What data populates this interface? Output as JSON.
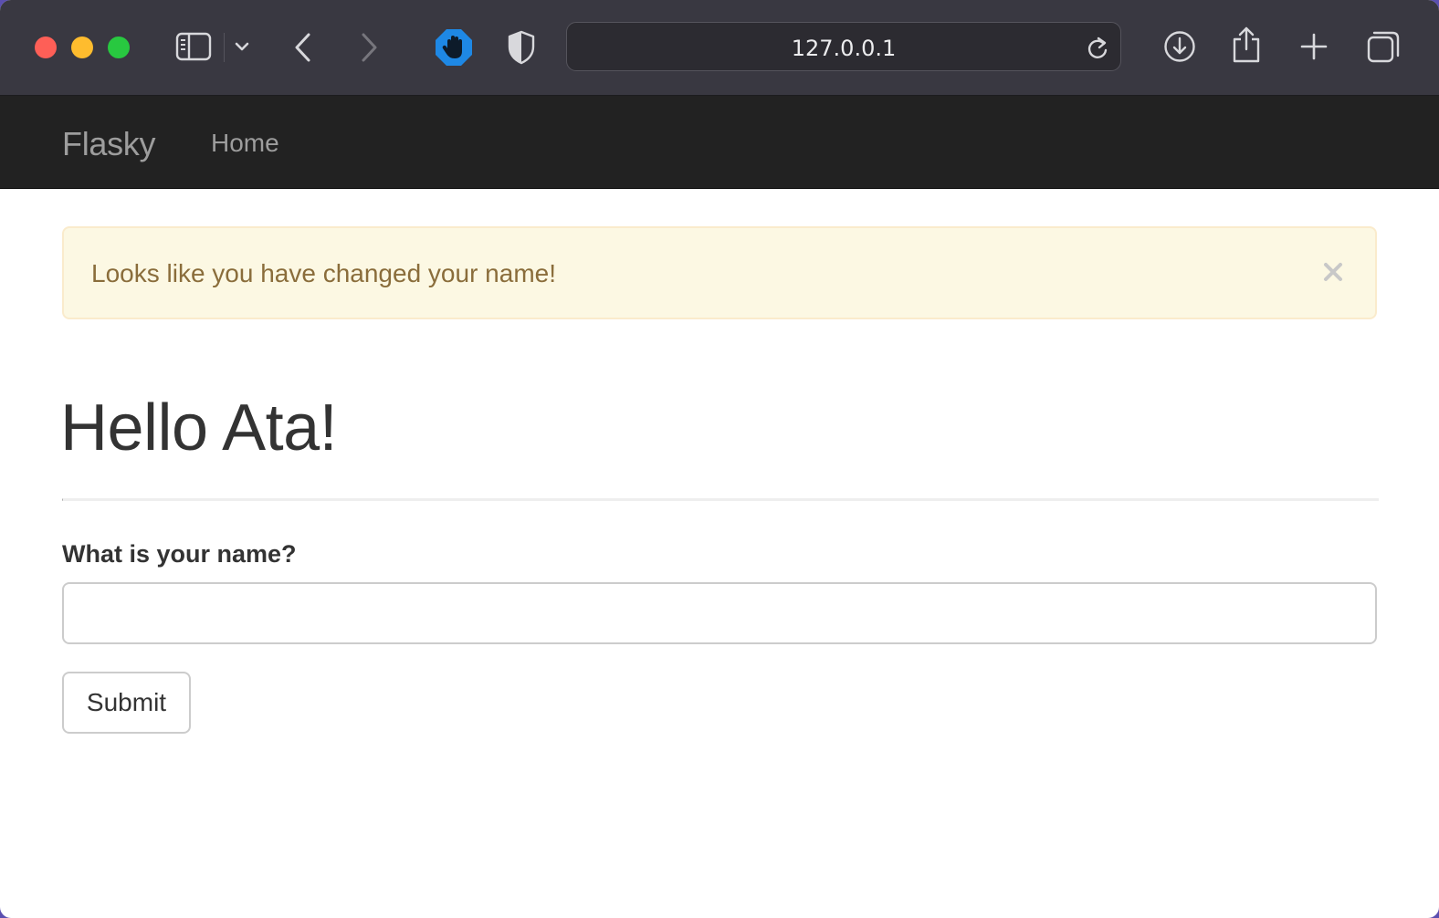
{
  "browser": {
    "url": "127.0.0.1",
    "icons": [
      "sidebar-icon",
      "chevron-down-icon",
      "back-icon",
      "forward-icon",
      "hand-blocker-icon",
      "shield-icon",
      "reload-icon",
      "download-icon",
      "share-icon",
      "new-tab-icon",
      "tabs-overview-icon"
    ]
  },
  "navbar": {
    "brand": "Flasky",
    "links": [
      {
        "label": "Home"
      }
    ]
  },
  "alert": {
    "message": "Looks like you have changed your name!",
    "close_icon": "close-icon"
  },
  "page": {
    "heading": "Hello Ata!"
  },
  "form": {
    "name_label": "What is your name?",
    "name_value": "",
    "submit_label": "Submit"
  },
  "colors": {
    "navbar_bg": "#222222",
    "alert_bg": "#fcf8e3",
    "alert_text": "#8a6d3b",
    "toolbar_bg": "#393841"
  }
}
